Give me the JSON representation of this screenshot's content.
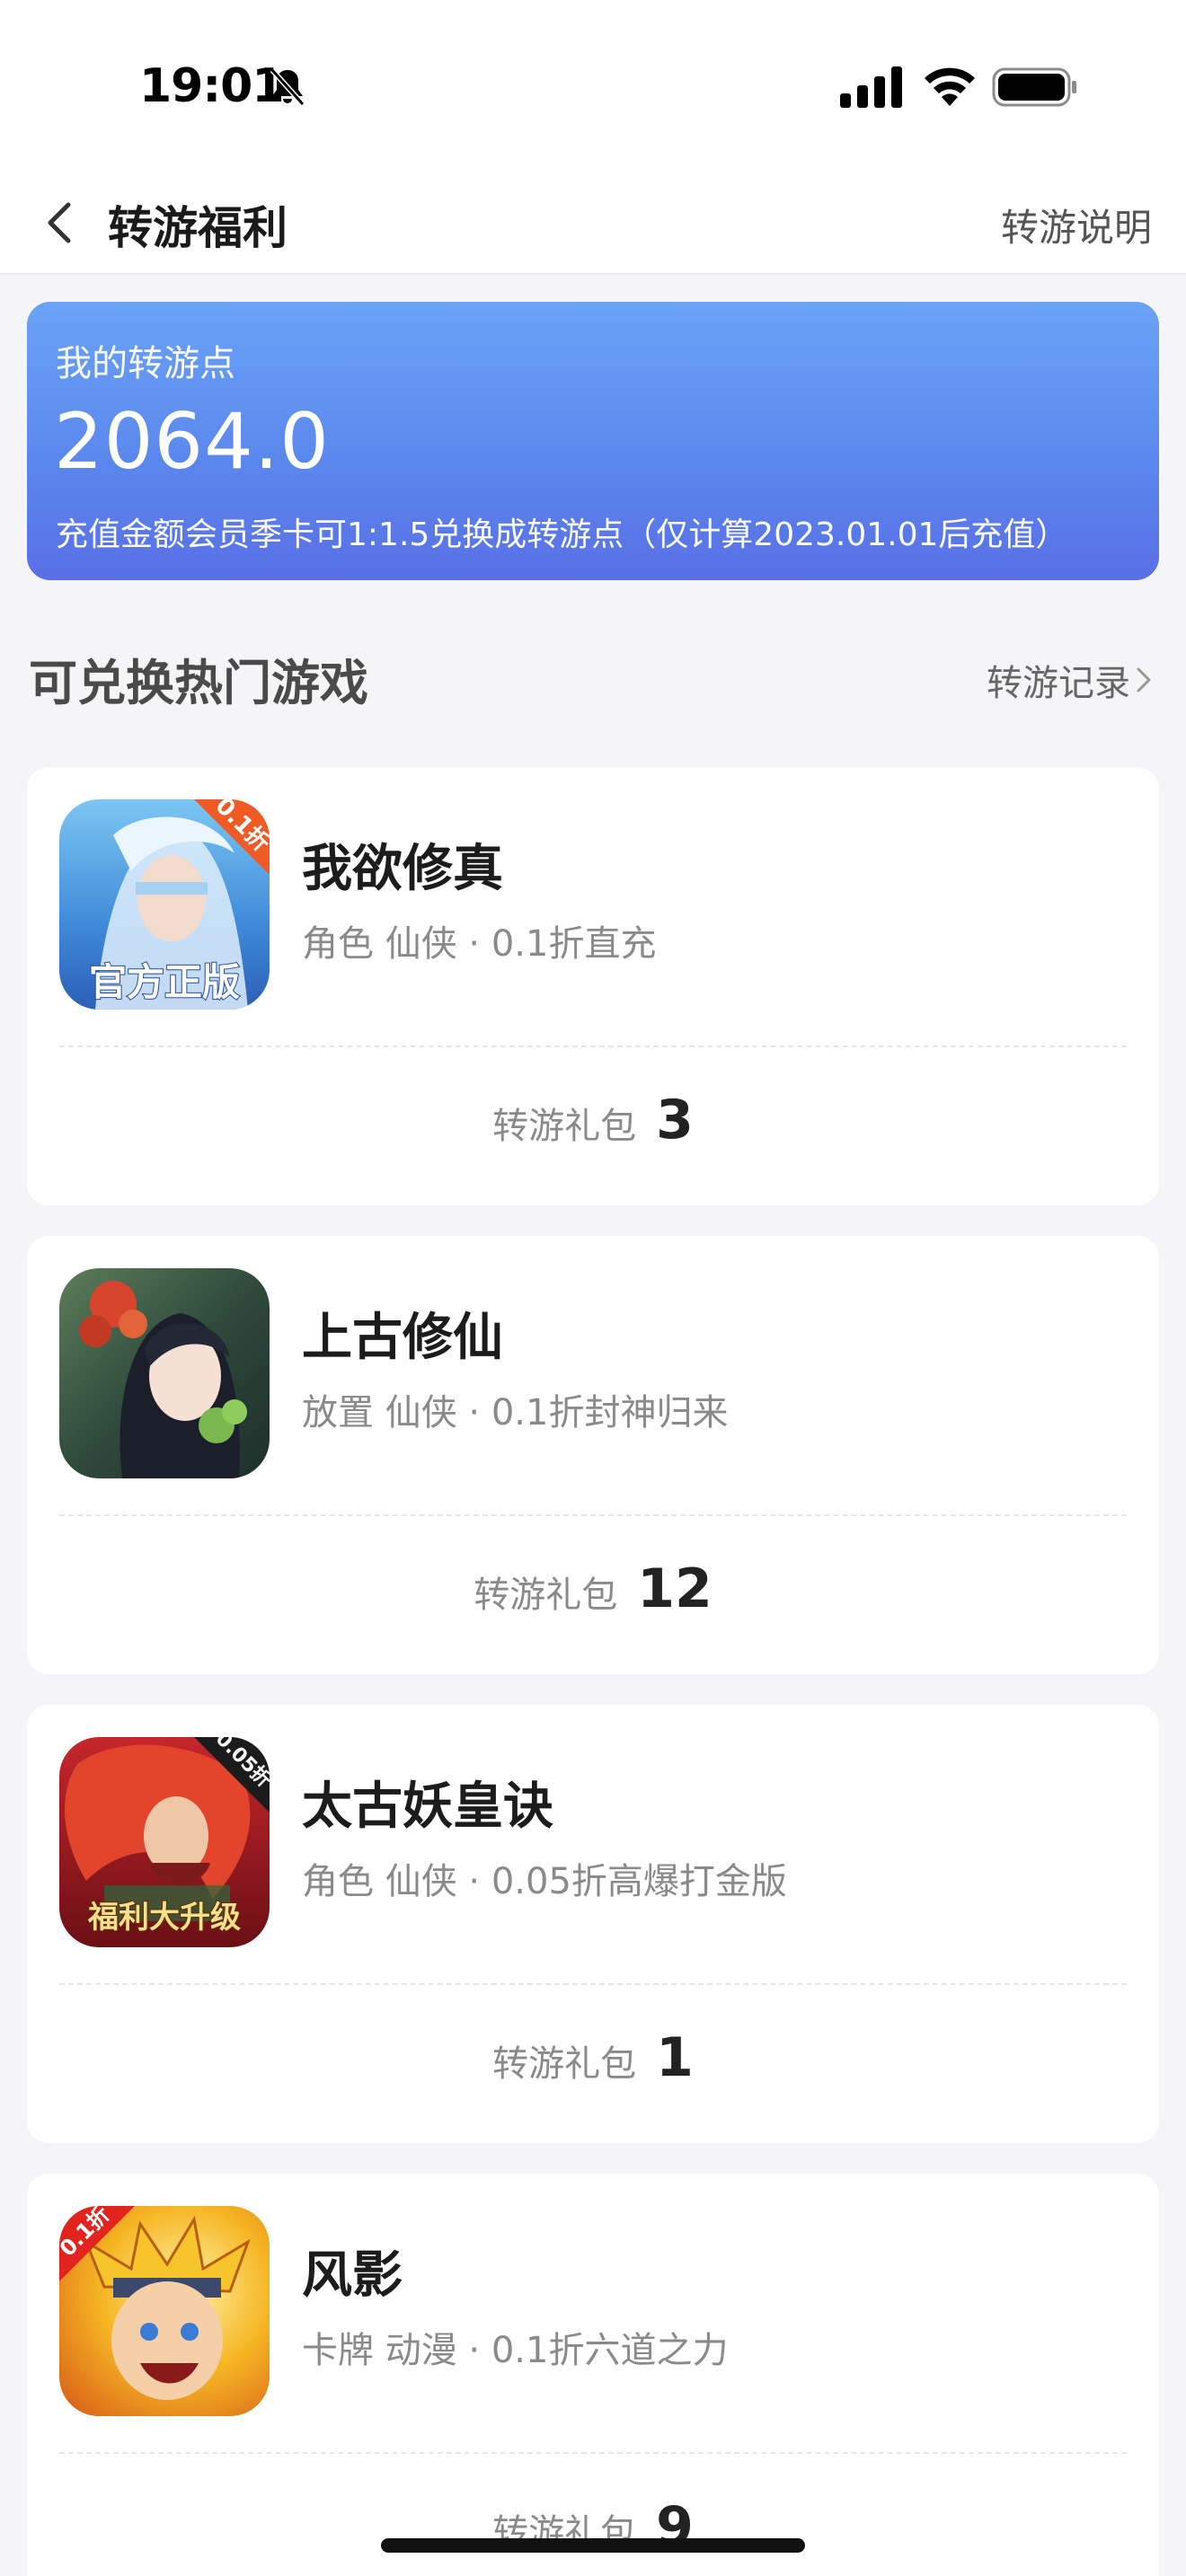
{
  "status_bar": {
    "time": "19:01",
    "icons": [
      "bell-slash-icon",
      "signal-icon",
      "wifi-icon",
      "battery-icon"
    ]
  },
  "nav": {
    "back_icon": "chevron-left-icon",
    "title": "转游福利",
    "action": "转游说明"
  },
  "points_card": {
    "label": "我的转游点",
    "value": "2064.0",
    "note": "充值金额会员季卡可1:1.5兑换成转游点（仅计算2023.01.01后充值）"
  },
  "section": {
    "title": "可兑换热门游戏",
    "link": "转游记录"
  },
  "games": [
    {
      "name": "我欲修真",
      "meta": "角色 仙侠 · 0.1折直充",
      "gift_label": "转游礼包",
      "gift_count": "3",
      "icon_badge": "0.1折",
      "icon_caption": "官方正版"
    },
    {
      "name": "上古修仙",
      "meta": "放置 仙侠 · 0.1折封神归来",
      "gift_label": "转游礼包",
      "gift_count": "12"
    },
    {
      "name": "太古妖皇诀",
      "meta": "角色 仙侠 · 0.05折高爆打金版",
      "gift_label": "转游礼包",
      "gift_count": "1",
      "icon_badge": "0.05折",
      "icon_caption": "福利大升级"
    },
    {
      "name": "风影",
      "meta": "卡牌 动漫 · 0.1折六道之力",
      "gift_label": "转游礼包",
      "gift_count": "9",
      "icon_badge": "0.1折"
    }
  ],
  "colors": {
    "card_gradient_top": "#6aa3f6",
    "card_gradient_bottom": "#5a6fe6",
    "page_background": "#f5f5f7"
  }
}
